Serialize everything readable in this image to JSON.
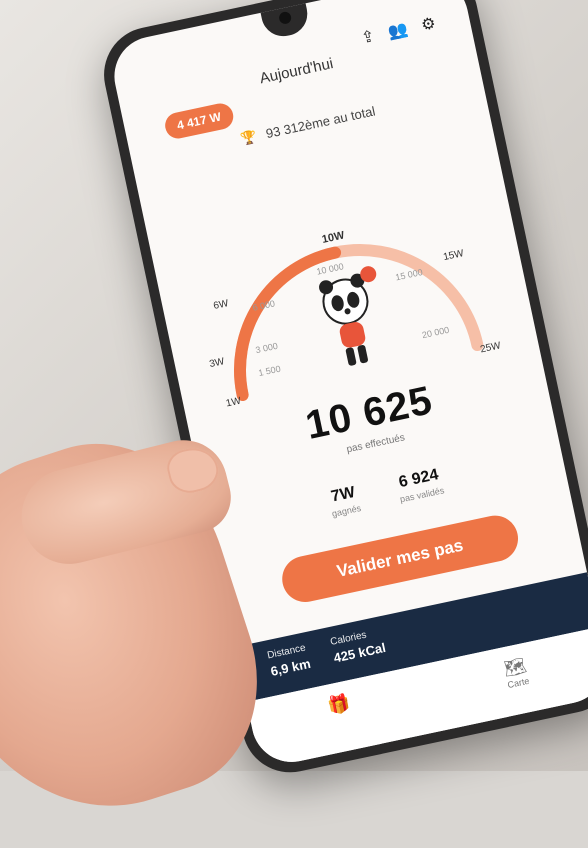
{
  "app": {
    "header_title": "Aujourd'hui",
    "steps_badge": "4 417 W",
    "rank_text": "93 312ème au total",
    "gauge_labels": [
      "1W",
      "3W",
      "6W",
      "10W",
      "15W",
      "25W"
    ],
    "gauge_scale": [
      "1 500",
      "3 000",
      "6 000",
      "10 000",
      "15 000",
      "20 000"
    ],
    "steps_value": "10 625",
    "steps_caption": "pas effectués",
    "stat_left_value": "7W",
    "stat_left_label": "gagnés",
    "stat_right_value": "6 924",
    "stat_right_label": "pas validés",
    "cta_label": "Valider mes pas",
    "distance_label": "Distance",
    "distance_value": "6,9 km",
    "calories_label": "Calories",
    "calories_value": "425 kCal",
    "tab_right_label": "Carte"
  },
  "colors": {
    "accent": "#ee7546",
    "accent_light": "#f6bfa7",
    "navy": "#1a2b43"
  },
  "icons": {
    "share": "share-icon",
    "friends": "friends-icon",
    "settings": "gear-icon",
    "rank": "trophy-icon",
    "gift": "gift-icon",
    "map": "map-icon"
  }
}
